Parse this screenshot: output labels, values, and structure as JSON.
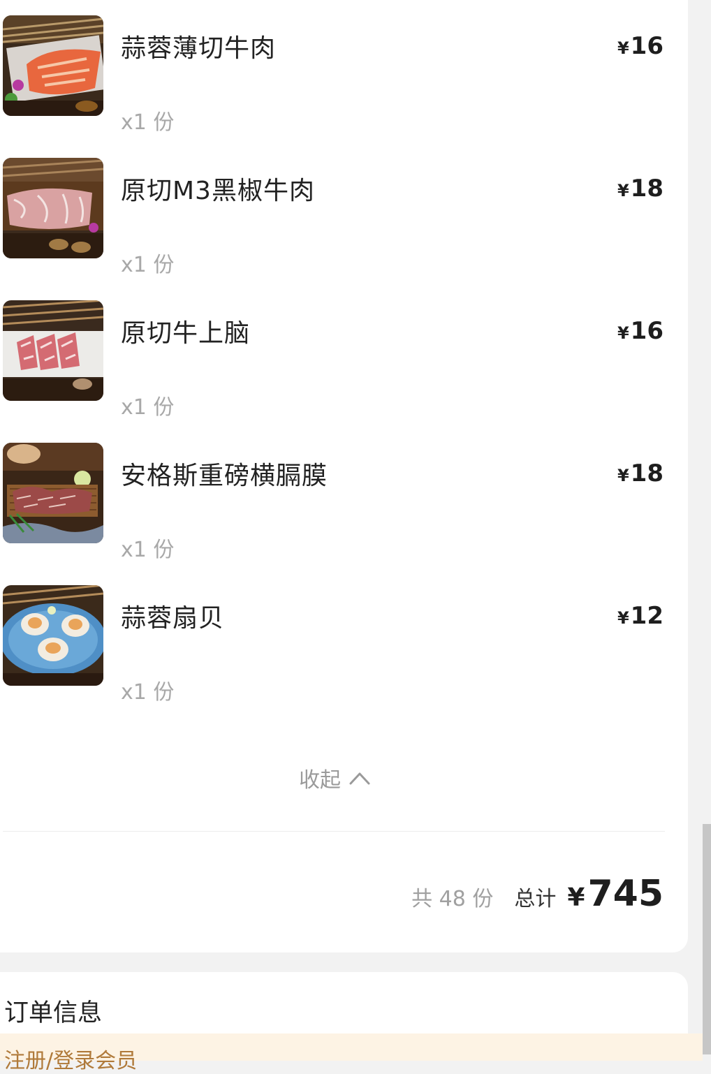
{
  "items": [
    {
      "name": "蒜蓉薄切牛肉",
      "price": "16",
      "qty": "x1 份",
      "image": "beef-slices-with-garlic"
    },
    {
      "name": "原切M3黑椒牛肉",
      "price": "18",
      "qty": "x1 份",
      "image": "black-pepper-beef-steak"
    },
    {
      "name": "原切牛上脑",
      "price": "16",
      "qty": "x1 份",
      "image": "marbled-beef-slices"
    },
    {
      "name": "安格斯重磅横膈膜",
      "price": "18",
      "qty": "x1 份",
      "image": "grilled-skirt-steak"
    },
    {
      "name": "蒜蓉扇贝",
      "price": "12",
      "qty": "x1 份",
      "image": "garlic-scallops"
    }
  ],
  "currency_symbol": "¥",
  "collapse": {
    "label": "收起",
    "icon": "chevron-up-icon"
  },
  "summary": {
    "count": "共 48 份",
    "total_label": "总计",
    "currency": "¥",
    "amount": "745"
  },
  "order_info": {
    "title": "订单信息",
    "notice": "注册/登录会员"
  },
  "colors": {
    "background": "#f2f2f2",
    "card": "#ffffff",
    "text_primary": "#222222",
    "text_secondary": "#a8a8a8",
    "notice_bg": "#fdf3e4"
  }
}
